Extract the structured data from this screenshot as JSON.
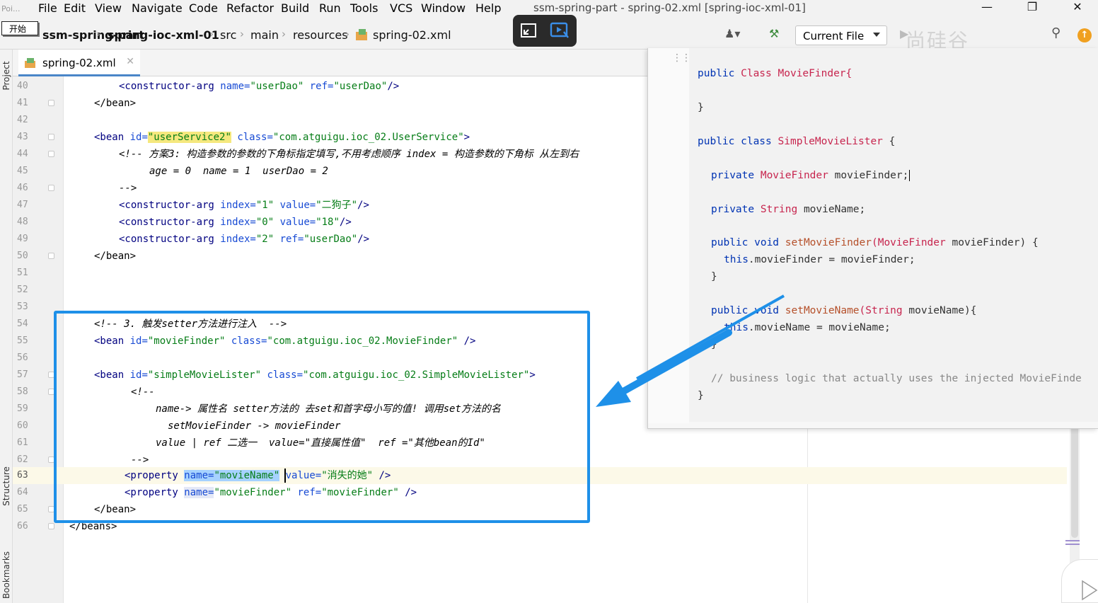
{
  "menu": {
    "poi": "Poi...",
    "popup": "开始",
    "items": [
      "File",
      "Edit",
      "View",
      "Navigate",
      "Code",
      "Refactor",
      "Build",
      "Run",
      "Tools",
      "VCS",
      "Window",
      "Help"
    ]
  },
  "window_title": "ssm-spring-part - spring-02.xml [spring-ioc-xml-01]",
  "breadcrumb": [
    "ssm-spring-part",
    "spring-ioc-xml-01",
    "src",
    "main",
    "resources",
    "spring-02.xml"
  ],
  "toolbar": {
    "current_file": "Current File",
    "watermark": "尚硅谷"
  },
  "side_labels": {
    "project": "Project",
    "structure": "Structure",
    "bookmarks": "Bookmarks"
  },
  "tab": {
    "filename": "spring-02.xml"
  },
  "line_numbers": [
    "40",
    "41",
    "42",
    "43",
    "44",
    "45",
    "46",
    "47",
    "48",
    "49",
    "50",
    "51",
    "52",
    "53",
    "54",
    "55",
    "56",
    "57",
    "58",
    "59",
    "60",
    "61",
    "62",
    "63",
    "64",
    "65",
    "66"
  ],
  "code": {
    "l40": {
      "tag": "<constructor-arg",
      "attr1": " name=",
      "val1": "\"userDao\"",
      "attr2": " ref=",
      "val2": "\"userDao\"",
      "end": "/>"
    },
    "l41": "</bean>",
    "l43": {
      "tag": "<bean",
      "attr1": " id=",
      "val1": "\"userService2\"",
      "attr2": " class=",
      "val2": "\"com.atguigu.ioc_02.UserService\"",
      "end": ">"
    },
    "l44": "<!-- 方案3: 构造参数的参数的下角标指定填写,不用考虑顺序 index = 构造参数的下角标 从左到右",
    "l45": "age = 0  name = 1  userDao = 2",
    "l46": "-->",
    "l47": {
      "tag": "<constructor-arg",
      "attr1": " index=",
      "val1": "\"1\"",
      "attr2": " value=",
      "val2": "\"二狗子\"",
      "end": "/>"
    },
    "l48": {
      "tag": "<constructor-arg",
      "attr1": " index=",
      "val1": "\"0\"",
      "attr2": " value=",
      "val2": "\"18\"",
      "end": "/>"
    },
    "l49": {
      "tag": "<constructor-arg",
      "attr1": " index=",
      "val1": "\"2\"",
      "attr2": " ref=",
      "val2": "\"userDao\"",
      "end": "/>"
    },
    "l50": "</bean>",
    "l54": "<!-- 3. 触发setter方法进行注入  -->",
    "l55": {
      "tag": "<bean",
      "attr1": " id=",
      "val1": "\"movieFinder\"",
      "attr2": " class=",
      "val2": "\"com.atguigu.ioc_02.MovieFinder\"",
      "end": " />"
    },
    "l57": {
      "tag": "<bean",
      "attr1": " id=",
      "val1": "\"simpleMovieLister\"",
      "attr2": " class=",
      "val2": "\"com.atguigu.ioc_02.SimpleMovieLister\"",
      "end": ">"
    },
    "l58": "<!--",
    "l59": "name-> 属性名 setter方法的 去set和首字母小写的值! 调用set方法的名",
    "l60": "setMovieFinder -> movieFinder",
    "l61": "value | ref 二选一  value=\"直接属性值\"  ref =\"其他bean的Id\"",
    "l62": "-->",
    "l63": {
      "tag": "<property",
      "attr1": "name=",
      "val1": "\"movieName\"",
      "attr2": "value=",
      "val2": "\"消失的她\"",
      "end": " />"
    },
    "l64": {
      "tag": "<property",
      "attr1": "name=",
      "val1": "\"movieFinder\"",
      "attr2": " ref=",
      "val2": "\"movieFinder\"",
      "end": " />"
    },
    "l65": "</bean>",
    "l66": "</beans>"
  },
  "overlay": {
    "o1a": "public ",
    "o1b": "Class ",
    "o1c": "MovieFinder{",
    "o2": "}",
    "o3a": "public class ",
    "o3b": "SimpleMovieLister ",
    "o3c": "{",
    "o4a": "private ",
    "o4b": "MovieFinder ",
    "o4c": "movieFinder;",
    "o5a": "private ",
    "o5b": "String ",
    "o5c": "movieName;",
    "o6a": "public void ",
    "o6b": "setMovieFinder",
    "o6c": "(MovieFinder ",
    "o6d": "movieFinder) {",
    "o7a": "this",
    "o7b": ".movieFinder = movieFinder;",
    "o8": "}",
    "o9a": "public void ",
    "o9b": "setMovieName",
    "o9c": "(String ",
    "o9d": "movieName){",
    "o10a": "this",
    "o10b": ".movieName = movieName;",
    "o11": "}",
    "o12": "// business logic that actually uses the injected MovieFinde",
    "o13": "}"
  }
}
